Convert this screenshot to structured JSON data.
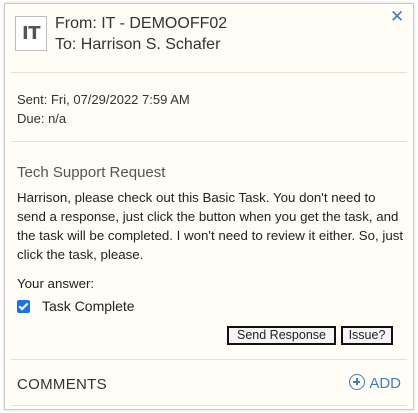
{
  "header": {
    "avatar_text": "IT",
    "from": "From: IT - DEMOOFF02",
    "to": "To: Harrison S. Schafer",
    "close_icon": "close-icon"
  },
  "meta": {
    "sent": "Sent: Fri, 07/29/2022 7:59 AM",
    "due": "Due: n/a"
  },
  "message": {
    "subject": "Tech Support Request",
    "body": "Harrison, please check out this Basic Task. You don't need to send a response, just click the button when you get the task, and the task will be completed. I won't need to review it either. So, just click the task, please.",
    "answer_label": "Your answer:"
  },
  "answer": {
    "checkbox_label": "Task Complete",
    "checked": true
  },
  "actions": {
    "send_label": "Send Response",
    "issue_label": "Issue?"
  },
  "comments": {
    "label": "COMMENTS",
    "add_label": "ADD"
  },
  "colors": {
    "accent": "#3a7fc1",
    "panel_bg": "#fffdf6",
    "checkbox": "#1a73e8"
  }
}
